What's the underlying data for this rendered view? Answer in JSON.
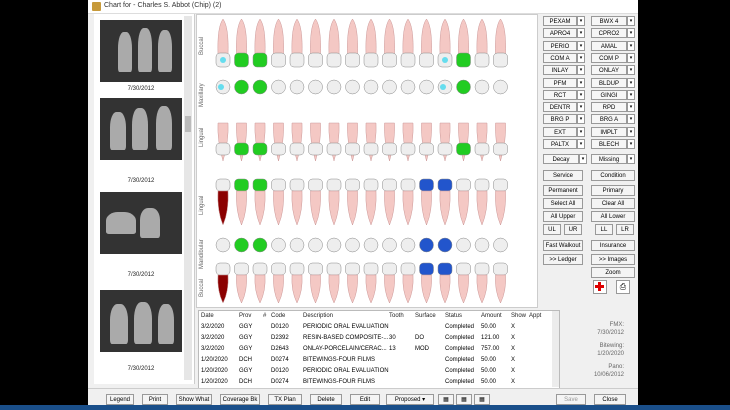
{
  "window": {
    "title": "Chart for - Charles S. Abbot (Chip) (2)"
  },
  "xrays": [
    {
      "date": "7/30/2012"
    },
    {
      "date": "7/30/2012"
    },
    {
      "date": "7/30/2012"
    },
    {
      "date": "7/30/2012"
    }
  ],
  "chart_labels": {
    "buccal": "Buccal",
    "maxillary": "Maxillary",
    "lingual": "Lingual",
    "lingual2": "Lingual",
    "mandibular": "Mandibular",
    "buccal2": "Buccal"
  },
  "procedure_buttons": {
    "left": [
      "PEXAM",
      "APRO4",
      "PERIO",
      "COM A",
      "INLAY",
      "PFM",
      "RCT",
      "DENTR",
      "BRG P",
      "EXT",
      "PALTX"
    ],
    "right": [
      "BWX 4",
      "CPRO2",
      "AMAL",
      "COM P",
      "ONLAY",
      "BLDUP",
      "GINGI",
      "RPD",
      "BRG A",
      "IMPLT",
      "BLECH"
    ]
  },
  "selectors": {
    "decay": "Decay",
    "missing": "Missing"
  },
  "actions": {
    "service": "Service",
    "condition": "Condition",
    "permanent": "Permanent",
    "primary": "Primary",
    "select_all": "Select All",
    "clear_all": "Clear All",
    "all_upper": "All Upper",
    "all_lower": "All Lower",
    "ul": "UL",
    "ur": "UR",
    "ll": "LL",
    "lr": "LR",
    "fast_walkout": "Fast Walkout",
    "insurance": "Insurance",
    "ledger": ">> Ledger",
    "images": ">> Images",
    "zoom": "Zoom"
  },
  "table": {
    "headers": [
      "Date",
      "Prov",
      "#",
      "Code",
      "Description",
      "Tooth",
      "Surface",
      "Status",
      "Amount",
      "Show",
      "Appt"
    ],
    "rows": [
      [
        "3/2/2020",
        "GGY",
        "",
        "D0120",
        "PERIODIC ORAL EVALUATION",
        "",
        "",
        "Completed",
        "50.00",
        "X",
        ""
      ],
      [
        "3/2/2020",
        "GGY",
        "",
        "D2392",
        "RESIN-BASED COMPOSITE-...",
        "30",
        "DO",
        "Completed",
        "121.00",
        "X",
        ""
      ],
      [
        "3/2/2020",
        "GGY",
        "",
        "D2643",
        "ONLAY-PORCELAIN/CERAC...",
        "13",
        "MOD",
        "Completed",
        "757.00",
        "X",
        ""
      ],
      [
        "1/20/2020",
        "DCH",
        "",
        "D0274",
        "BITEWINGS-FOUR FILMS",
        "",
        "",
        "Completed",
        "50.00",
        "X",
        ""
      ],
      [
        "1/20/2020",
        "GGY",
        "",
        "D0120",
        "PERIODIC ORAL EVALUATION",
        "",
        "",
        "Completed",
        "50.00",
        "X",
        ""
      ],
      [
        "1/20/2020",
        "DCH",
        "",
        "D0274",
        "BITEWINGS-FOUR FILMS",
        "",
        "",
        "Completed",
        "50.00",
        "X",
        ""
      ]
    ]
  },
  "right_info": {
    "fmx_label": "FMX:",
    "fmx": "7/30/2012",
    "bitewing_label": "Bitewing:",
    "bitewing": "1/20/2020",
    "pano_label": "Pano:",
    "pano": "10/06/2012"
  },
  "bottom_buttons": [
    "Legend",
    "Print",
    "Show What",
    "Coverage Bk",
    "TX Plan",
    "Delete",
    "Edit"
  ],
  "status_select": "Proposed",
  "save": "Save",
  "close": "Close",
  "colors": {
    "restoration_green": "#22cc22",
    "sealant_cyan": "#66ddee",
    "blue_fill": "#2255cc",
    "decay_red": "#8b0000",
    "tooth_pink": "#f4c8c4"
  }
}
